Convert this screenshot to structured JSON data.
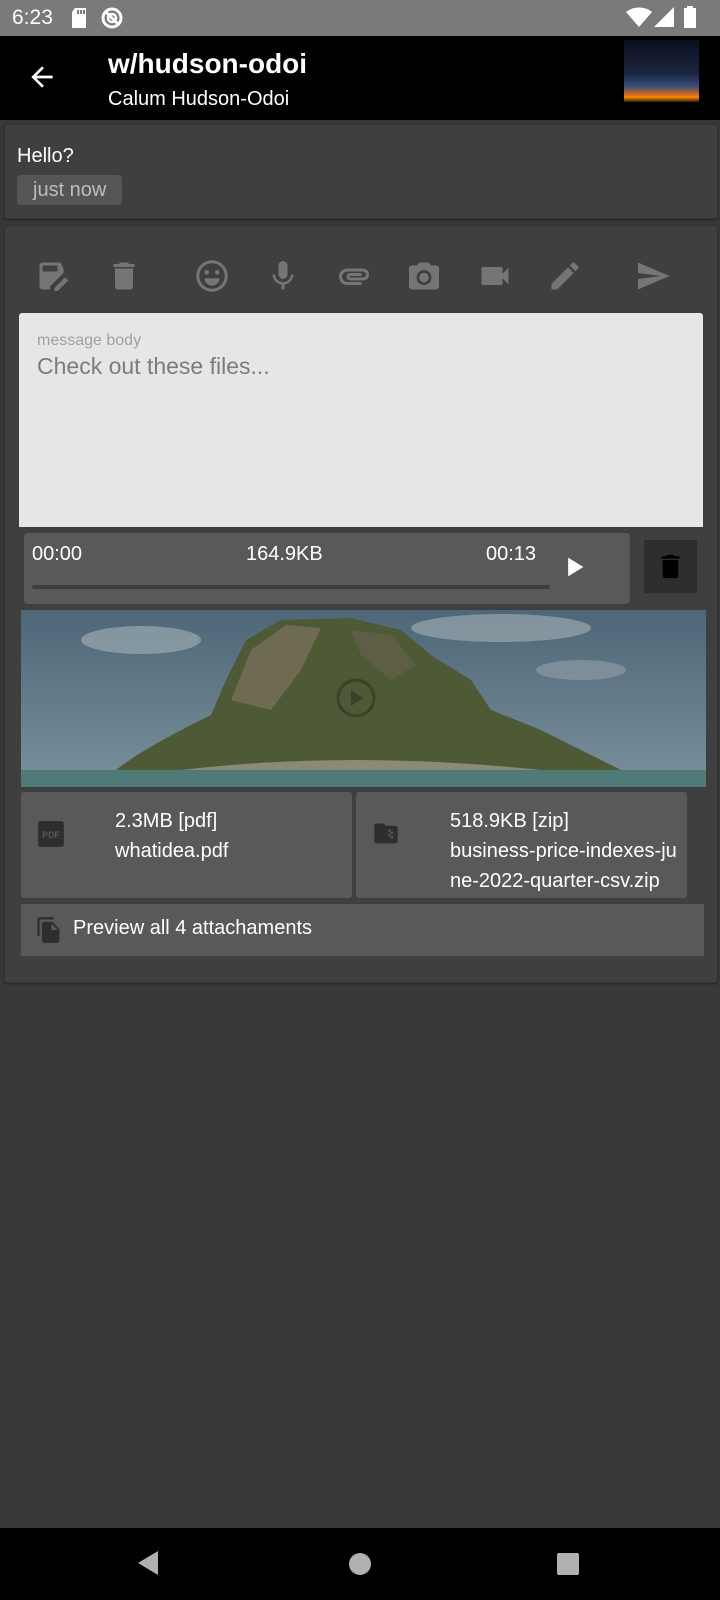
{
  "status_bar": {
    "time": "6:23",
    "icons": [
      "sd-card-icon",
      "no-disturb-icon",
      "wifi-icon",
      "signal-icon",
      "battery-icon"
    ]
  },
  "app_bar": {
    "title": "w/hudson-odoi",
    "subtitle": "Calum Hudson-Odoi",
    "back_icon": "arrow-back-icon"
  },
  "message": {
    "text": "Hello?",
    "time": "just now"
  },
  "compose": {
    "toolbar": [
      "save-draft-icon",
      "delete-icon",
      "emoji-icon",
      "microphone-icon",
      "attach-icon",
      "camera-icon",
      "video-icon",
      "pen-icon",
      "send-icon"
    ],
    "body_placeholder": "message body",
    "body_value": "Check out these files...",
    "audio": {
      "start": "00:00",
      "size": "164.9KB",
      "end": "00:13",
      "progress": 0
    },
    "files": [
      {
        "size": "2.3MB [pdf]",
        "name": "whatidea.pdf",
        "icon": "pdf-icon"
      },
      {
        "size": "518.9KB [zip]",
        "name_line1": "business-price-indexes-ju",
        "name_line2": "ne-2022-quarter-csv.zip",
        "icon": "zip-folder-icon"
      }
    ],
    "preview_label": "Preview all 4 attachaments"
  },
  "colors": {
    "background": "#383838",
    "card": "#3f3f3f",
    "attachment": "#595959",
    "field": "#e6e6e6",
    "icon": "#757575"
  }
}
